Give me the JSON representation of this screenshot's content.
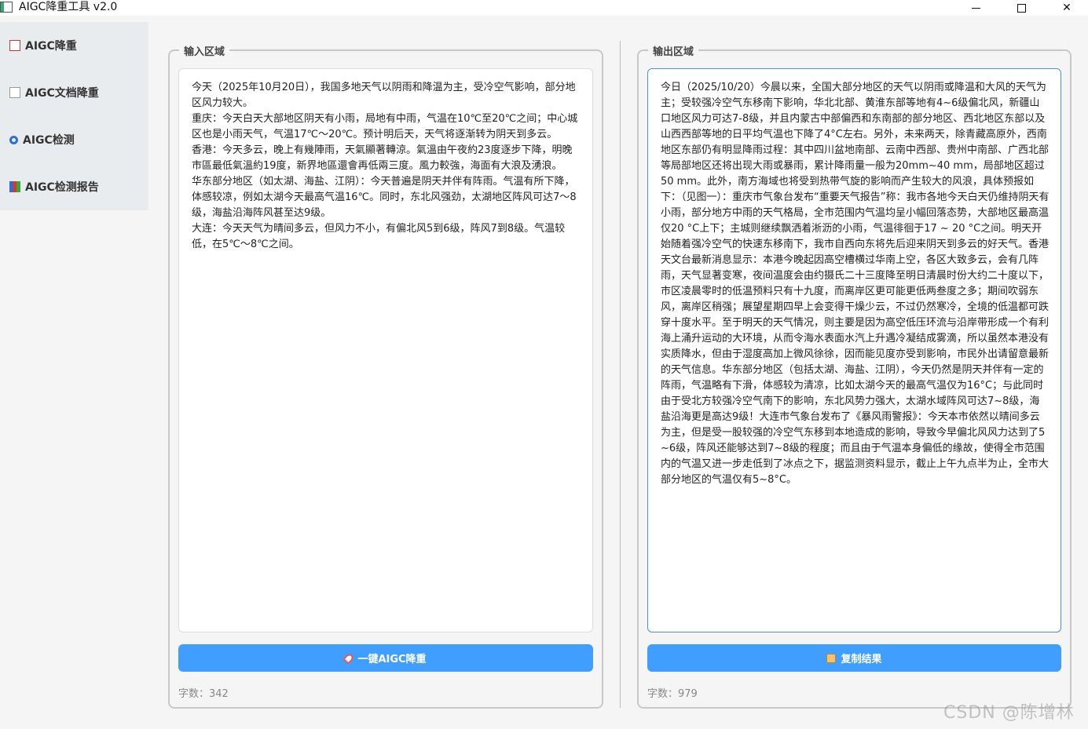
{
  "window": {
    "title": "AIGC降重工具 v2.0"
  },
  "sidebar": {
    "items": [
      {
        "label": "AIGC降重",
        "icon": "pencil-doc-icon"
      },
      {
        "label": "AIGC文档降重",
        "icon": "document-icon"
      },
      {
        "label": "AIGC检测",
        "icon": "magnifier-icon"
      },
      {
        "label": "AIGC检测报告",
        "icon": "bar-chart-icon"
      }
    ]
  },
  "input_panel": {
    "title": "输入区域",
    "text": "今天（2025年10月20日），我国多地天气以阴雨和降温为主，受冷空气影响，部分地区风力较大。\n重庆：今天白天大部地区阴天有小雨，局地有中雨，气温在10℃至20℃之间；中心城区也是小雨天气，气温17℃～20℃。预计明后天，天气将逐渐转为阴天到多云。\n香港：今天多云，晚上有幾陣雨，天氣顯著轉涼。氣溫由午夜約23度逐步下降，明晚市區最低氣溫約19度，新界地區還會再低兩三度。風力較強，海面有大浪及湧浪。\n华东部分地区（如太湖、海盐、江阴）：今天普遍是阴天并伴有阵雨。气温有所下降，体感较凉，例如太湖今天最高气温16℃。同时，东北风强劲，太湖地区阵风可达7～8级，海盐沿海阵风甚至达9级。\n大连：今天天气为晴间多云，但风力不小，有偏北风5到6级，阵风7到8级。气温较低，在5℃～8℃之间。",
    "button_label": "一键AIGC降重",
    "count_label": "字数：342"
  },
  "output_panel": {
    "title": "输出区域",
    "text": "今日（2025/10/20）今晨以来，全国大部分地区的天气以阴雨或降温和大风的天气为主；受较强冷空气东移南下影响，华北北部、黄淮东部等地有4~6级偏北风，新疆山口地区风力可达7-8级，并且内蒙古中部偏西和东南部的部分地区、西北地区东部以及山西西部等地的日平均气温也下降了4°C左右。另外，未来两天，除青藏高原外，西南地区东部仍有明显降雨过程：其中四川盆地南部、云南中西部、贵州中南部、广西北部等局部地区还将出现大雨或暴雨，累计降雨量一般为20mm~40 mm，局部地区超过50 mm。此外，南方海域也将受到热带气旋的影响而产生较大的风浪，具体预报如下：（见图一）：重庆市气象台发布“重要天气报告”称：我市各地今天白天仍维持阴天有小雨，部分地方中雨的天气格局，全市范围内气温均呈小幅回落态势，大部地区最高温仅20 °C上下；主城则继续飘洒着淅沥的小雨，气温徘徊于17 ~ 20 °C之间。明天开始随着强冷空气的快速东移南下，我市自西向东将先后迎来阴天到多云的好天气。香港天文台最新消息显示：本港今晚起因高空槽横过华南上空，各区大致多云，会有几阵雨，天气显著变寒，夜间温度会由约摄氏二十三度降至明日清晨时份大约二十度以下，市区凌晨零时的低温预料只有十九度，而离岸区更可能更低两叁度之多；期间吹弱东风，离岸区稍强；展望星期四早上会变得干燥少云，不过仍然寒冷，全境的低温都可跌穿十度水平。至于明天的天气情况，则主要是因为高空低压环流与沿岸带形成一个有利海上涌升运动的大环境，从而令海水表面水汽上升遇冷凝结成雾滴，所以虽然本港没有实质降水，但由于湿度高加上微风徐徐，因而能见度亦受到影响，市民外出请留意最新的天气信息。华东部分地区（包括太湖、海盐、江阴），今天仍然是阴天并伴有一定的阵雨，气温略有下滑，体感较为清凉，比如太湖今天的最高气温仅为16°C；与此同时由于受北方较强冷空气南下的影响，东北风势力强大，太湖水域阵风可达7~8级，海盐沿海更是高达9级！大连市气象台发布了《暴风雨警报》：今天本市依然以晴间多云为主，但是受一股较强的冷空气东移到本地造成的影响，导致今早偏北风风力达到了5~6级，阵风还能够达到7~8级的程度；而且由于气温本身偏低的缘故，使得全市范围内的气温又进一步走低到了冰点之下，据监测资料显示，截止上午九点半为止，全市大部分地区的气温仅有5~8°C。",
    "button_label": "复制结果",
    "count_label": "字数：979"
  },
  "watermark": "CSDN @陈增林",
  "colors": {
    "primary_button": "#409eff",
    "sidebar_bg": "#e9ecef",
    "focus_border": "#4a90e2"
  }
}
